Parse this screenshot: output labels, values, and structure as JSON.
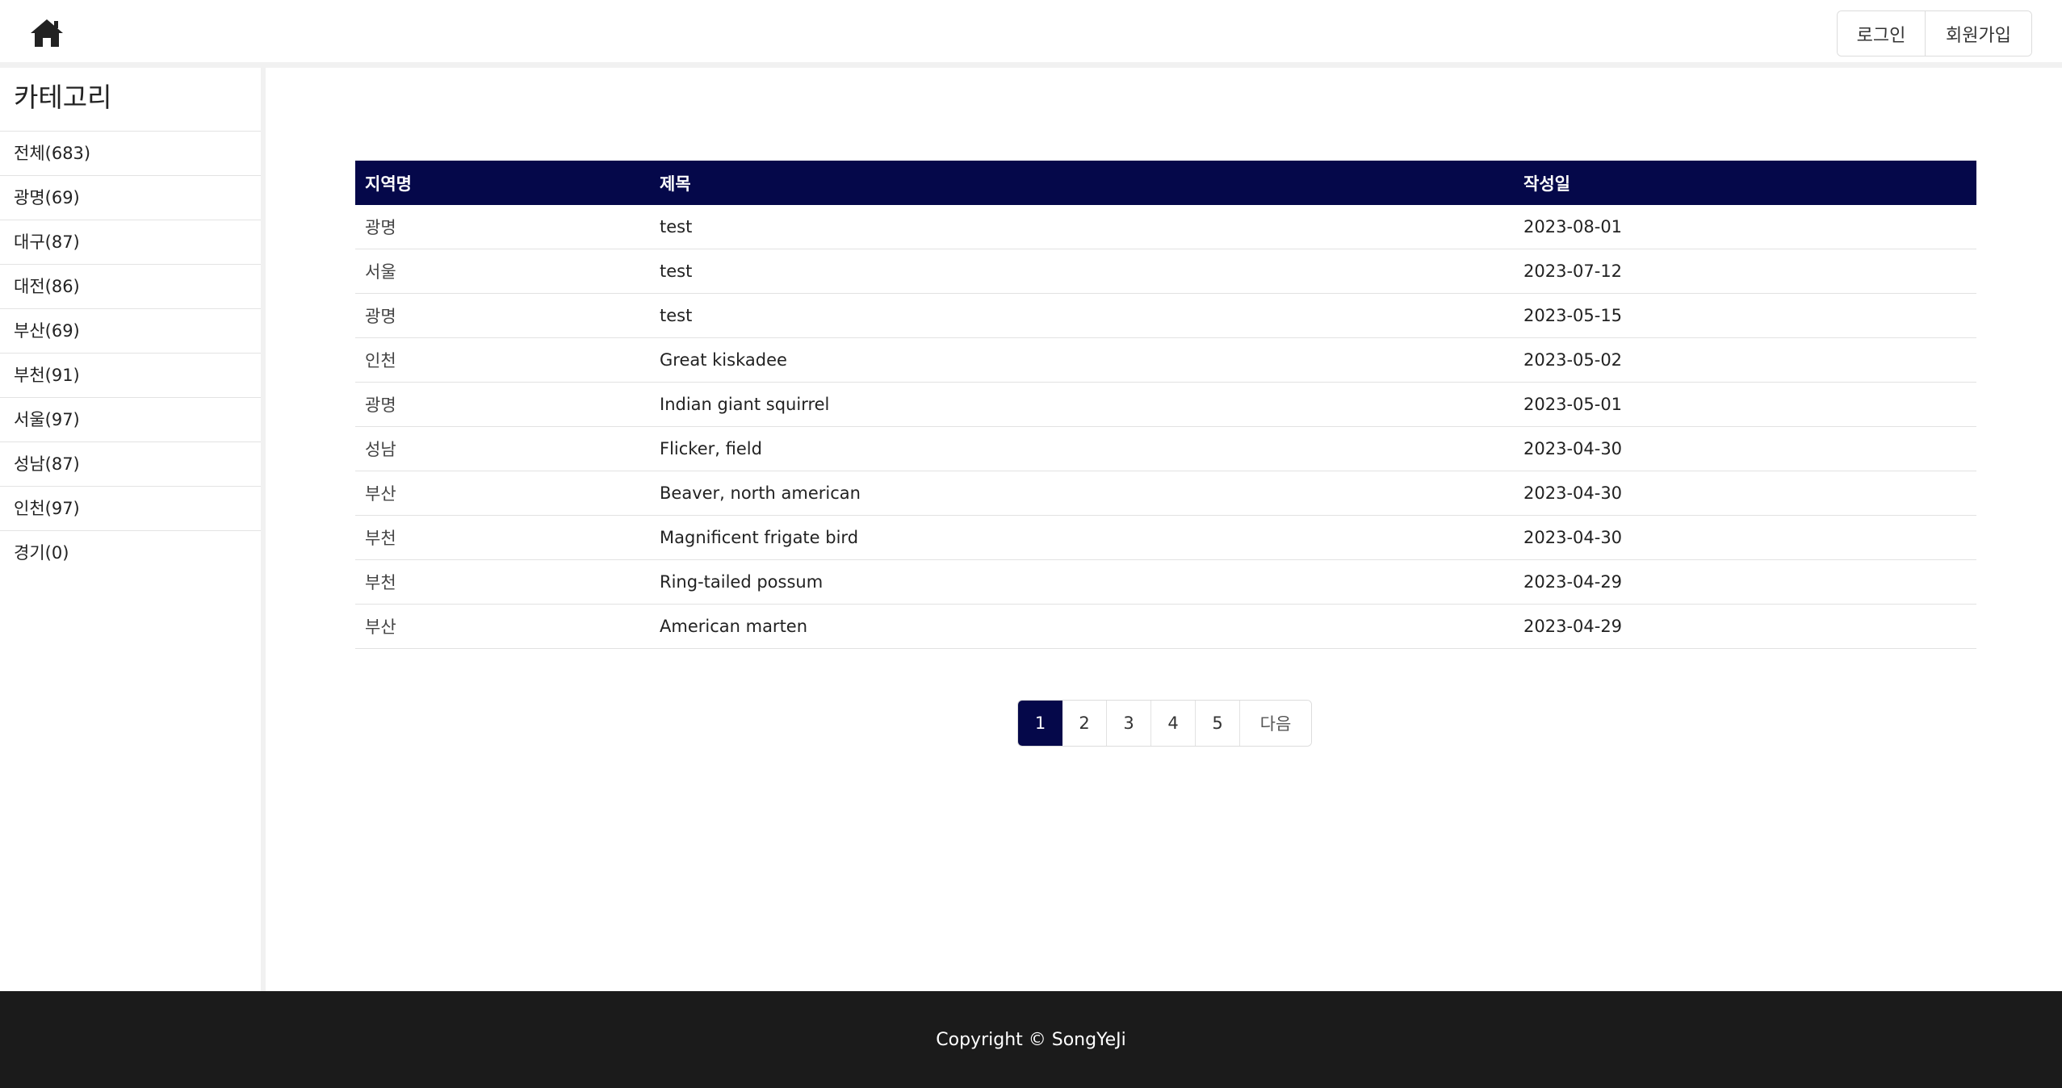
{
  "header": {
    "home_icon": "home-icon",
    "login_label": "로그인",
    "signup_label": "회원가입"
  },
  "sidebar": {
    "title": "카테고리",
    "items": [
      {
        "label": "전체(683)"
      },
      {
        "label": "광명(69)"
      },
      {
        "label": "대구(87)"
      },
      {
        "label": "대전(86)"
      },
      {
        "label": "부산(69)"
      },
      {
        "label": "부천(91)"
      },
      {
        "label": "서울(97)"
      },
      {
        "label": "성남(87)"
      },
      {
        "label": "인천(97)"
      },
      {
        "label": "경기(0)"
      }
    ]
  },
  "table": {
    "headers": {
      "region": "지역명",
      "title": "제목",
      "date": "작성일"
    },
    "rows": [
      {
        "region": "광명",
        "title": "test",
        "date": "2023-08-01"
      },
      {
        "region": "서울",
        "title": "test",
        "date": "2023-07-12"
      },
      {
        "region": "광명",
        "title": "test",
        "date": "2023-05-15"
      },
      {
        "region": "인천",
        "title": "Great kiskadee",
        "date": "2023-05-02"
      },
      {
        "region": "광명",
        "title": "Indian giant squirrel",
        "date": "2023-05-01"
      },
      {
        "region": "성남",
        "title": "Flicker, field",
        "date": "2023-04-30"
      },
      {
        "region": "부산",
        "title": "Beaver, north american",
        "date": "2023-04-30"
      },
      {
        "region": "부천",
        "title": "Magnificent frigate bird",
        "date": "2023-04-30"
      },
      {
        "region": "부천",
        "title": "Ring-tailed possum",
        "date": "2023-04-29"
      },
      {
        "region": "부산",
        "title": "American marten",
        "date": "2023-04-29"
      }
    ]
  },
  "pagination": {
    "pages": [
      "1",
      "2",
      "3",
      "4",
      "5"
    ],
    "current": "1",
    "next_label": "다음"
  },
  "footer": {
    "copyright": "Copyright © SongYeJi"
  },
  "colors": {
    "accent": "#05084a",
    "footer_bg": "#1b1b1b"
  }
}
